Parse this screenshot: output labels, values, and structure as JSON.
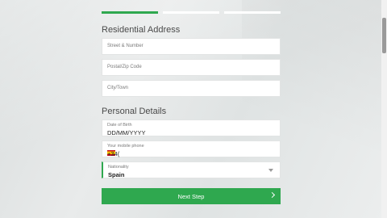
{
  "progress": {
    "steps_total": 3,
    "current_step": 1
  },
  "residential": {
    "title": "Residential Address",
    "street_placeholder": "Street & Number",
    "postal_placeholder": "Postal/Zip Code",
    "city_placeholder": "City/Town"
  },
  "personal": {
    "title": "Personal Details",
    "dob_label": "Date of Birth",
    "dob_value": "DD/MM/YYYY",
    "phone_label": "Your mobile phone",
    "phone_value": "+34(",
    "phone_flag": "spain-flag-icon",
    "nationality_label": "Nationality",
    "nationality_value": "Spain"
  },
  "actions": {
    "next_label": "Next Step"
  },
  "colors": {
    "accent": "#2fa84f",
    "field_bg": "#ffffff",
    "background": "#e4e7e7"
  }
}
